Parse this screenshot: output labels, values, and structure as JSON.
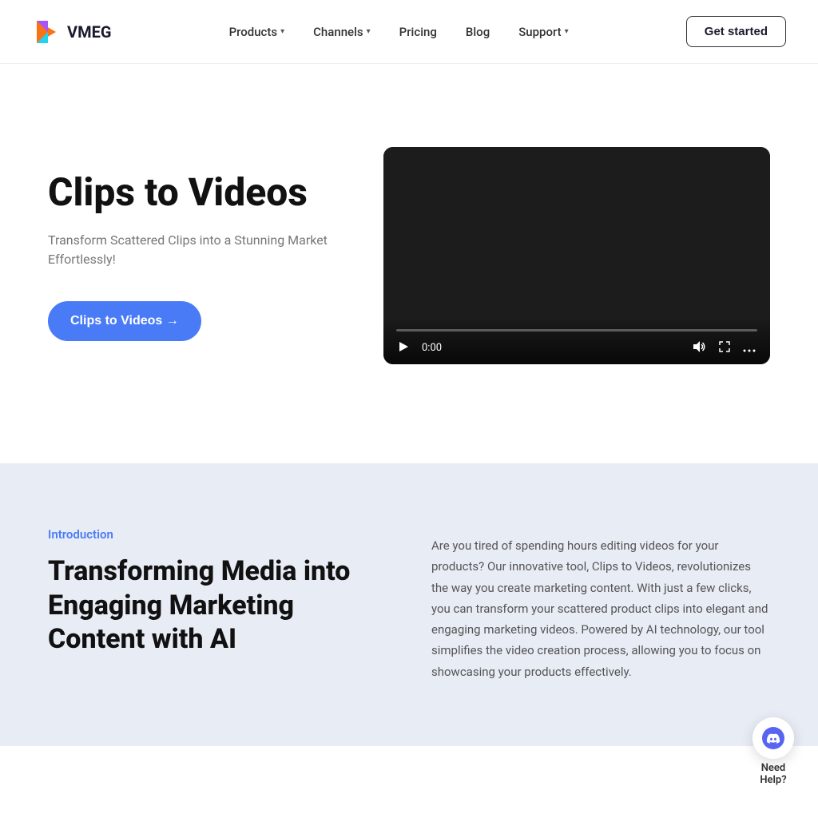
{
  "logo": {
    "text": "VMEG"
  },
  "nav": {
    "items": [
      {
        "label": "Products",
        "has_dropdown": true
      },
      {
        "label": "Channels",
        "has_dropdown": true
      },
      {
        "label": "Pricing",
        "has_dropdown": false
      },
      {
        "label": "Blog",
        "has_dropdown": false
      },
      {
        "label": "Support",
        "has_dropdown": true
      }
    ],
    "cta": "Get started"
  },
  "hero": {
    "title": "Clips to Videos",
    "subtitle": "Transform Scattered Clips into a Stunning Market Effortlessly!",
    "cta_button": "Clips to Videos →",
    "video": {
      "time": "0:00",
      "duration": "0:00"
    }
  },
  "intro": {
    "label": "Introduction",
    "heading": "Transforming Media into Engaging Marketing Content with AI",
    "body": "Are you tired of spending hours editing videos for your products? Our innovative tool, Clips to Videos, revolutionizes the way you create marketing content. With just a few clicks, you can transform your scattered product clips into elegant and engaging marketing videos. Powered by AI technology, our tool simplifies the video creation process, allowing you to focus on showcasing your products effectively."
  },
  "discord": {
    "label": "Need\nHelp?"
  }
}
